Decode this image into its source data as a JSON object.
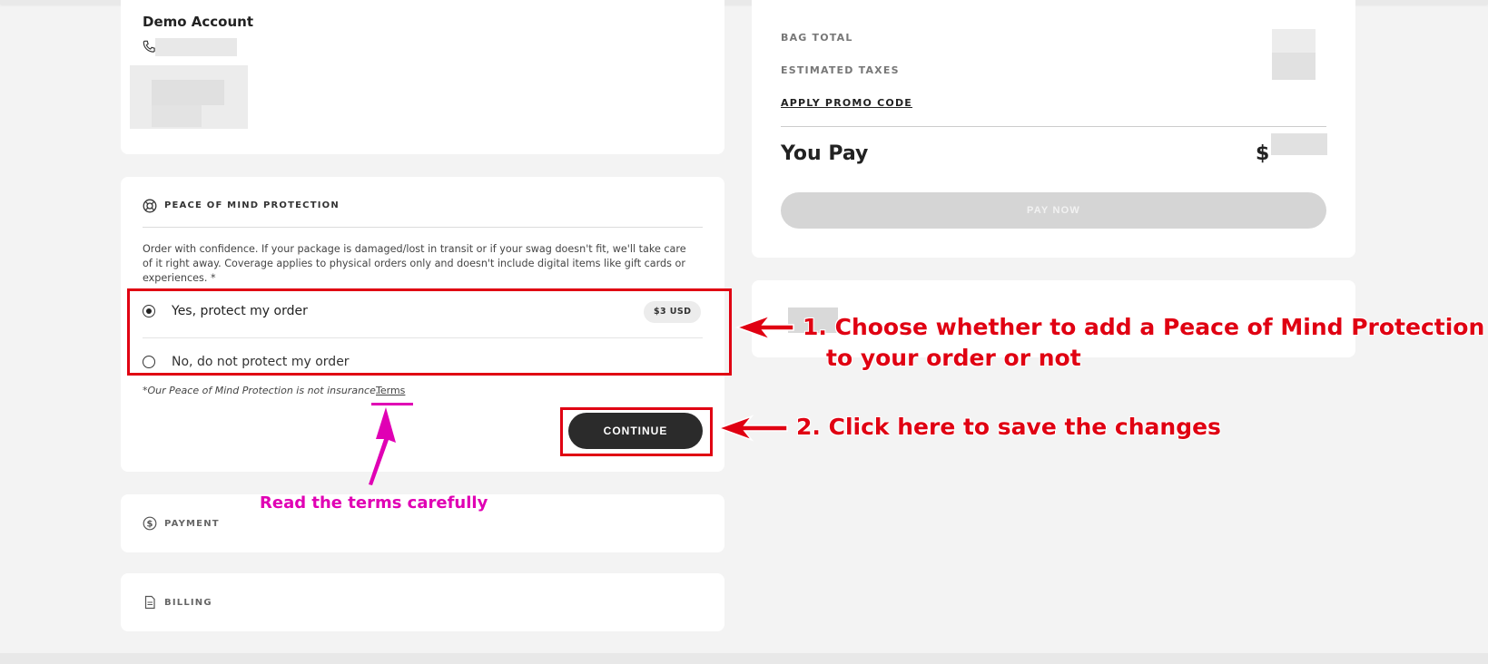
{
  "shipping": {
    "name": "Demo Account",
    "phone_icon": "phone-icon"
  },
  "peace_of_mind": {
    "icon": "lifebuoy-icon",
    "title": "PEACE OF MIND PROTECTION",
    "description": "Order with confidence. If your package is damaged/lost in transit or if your swag doesn't fit, we'll take care of it right away. Coverage applies to physical orders only and doesn't include digital items like gift cards or experiences. *",
    "options": [
      {
        "label": "Yes, protect my order",
        "price": "$3 USD",
        "selected": true
      },
      {
        "label": "No, do not protect my order",
        "selected": false
      }
    ],
    "disclaimer": "*Our Peace of Mind Protection is not insurance.",
    "terms_label": "Terms",
    "continue_label": "CONTINUE"
  },
  "payment": {
    "icon": "dollar-circle-icon",
    "title": "PAYMENT"
  },
  "billing": {
    "icon": "document-icon",
    "title": "BILLING"
  },
  "summary": {
    "bag_total_label": "BAG TOTAL",
    "estimated_taxes_label": "ESTIMATED TAXES",
    "promo_label": "APPLY PROMO CODE",
    "you_pay_label": "You Pay",
    "you_pay_amount_visible": "$",
    "pay_now_label": "PAY NOW"
  },
  "annotations": {
    "step1_line1": "1. Choose whether to add a Peace of Mind Protection",
    "step1_line2": "to your order or not",
    "step2": "2. Click here to save the changes",
    "terms_note": "Read the terms carefully",
    "red_color": "#e00012",
    "pink_color": "#e000b4"
  }
}
